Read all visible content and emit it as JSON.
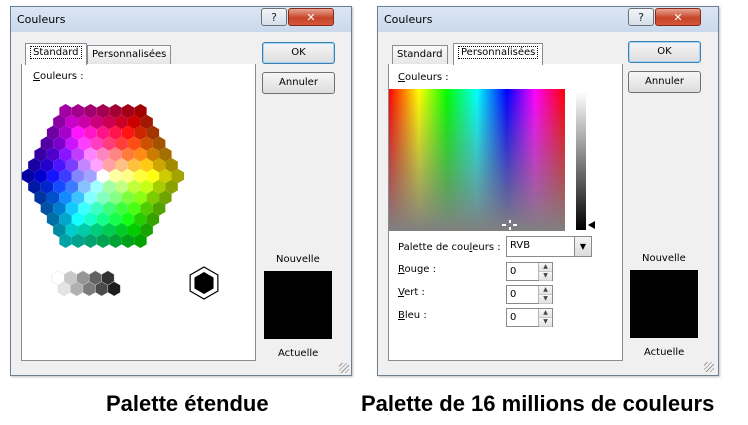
{
  "left_dialog": {
    "title": "Couleurs",
    "help_glyph": "?",
    "close_glyph": "✕",
    "tabs": [
      {
        "label": "Standard",
        "active": true
      },
      {
        "label": "Personnalisées",
        "active": false
      }
    ],
    "colors_label_prefix": "C",
    "colors_label_rest": "ouleurs :",
    "ok_label": "OK",
    "cancel_label": "Annuler",
    "new_label": "Nouvelle",
    "current_label": "Actuelle",
    "selected_color": "#000000"
  },
  "right_dialog": {
    "title": "Couleurs",
    "help_glyph": "?",
    "close_glyph": "✕",
    "tabs": [
      {
        "label": "Standard",
        "active": false
      },
      {
        "label": "Personnalisées",
        "active": true
      }
    ],
    "colors_label_prefix": "C",
    "colors_label_rest": "ouleurs :",
    "model_label_a": "Palette de cou",
    "model_label_u": "l",
    "model_label_b": "eurs :",
    "model_value": "RVB",
    "model_arrow": "▼",
    "red_label_prefix": "R",
    "red_label_rest": "ouge :",
    "red_value": "0",
    "green_label_prefix": "V",
    "green_label_rest": "ert :",
    "green_value": "0",
    "blue_label_prefix": "B",
    "blue_label_rest": "leu :",
    "blue_value": "0",
    "spin_up": "▲",
    "spin_down": "▼",
    "ok_label": "OK",
    "cancel_label": "Annuler",
    "new_label": "Nouvelle",
    "current_label": "Actuelle",
    "selected_color": "#000000"
  },
  "captions": {
    "left": "Palette étendue",
    "right": "Palette de 16 millions de couleurs"
  }
}
